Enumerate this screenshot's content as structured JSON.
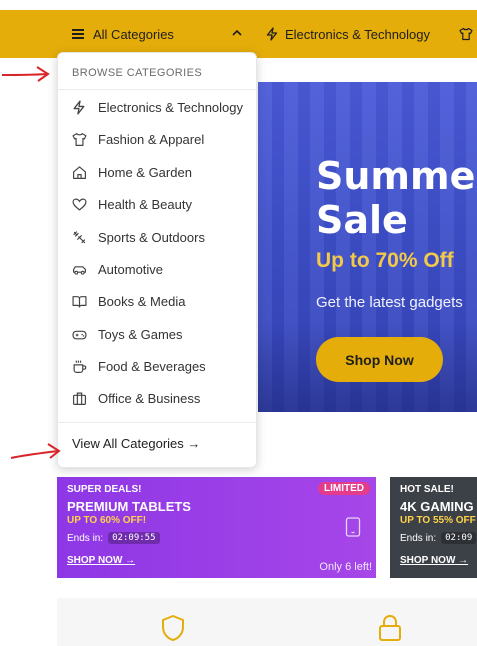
{
  "navbar": {
    "all_categories": "All Categories",
    "first_category": "Electronics & Technology",
    "bg_color": "#e5ad0a"
  },
  "hero": {
    "title_line1": "Summer",
    "title_line2": "Sale",
    "subtitle": "Up to 70% Off",
    "description": "Get the latest gadgets",
    "button": "Shop Now"
  },
  "dropdown": {
    "heading": "BROWSE CATEGORIES",
    "items": [
      {
        "label": "Electronics & Technology",
        "icon": "lightning-icon"
      },
      {
        "label": "Fashion & Apparel",
        "icon": "shirt-icon"
      },
      {
        "label": "Home & Garden",
        "icon": "home-icon"
      },
      {
        "label": "Health & Beauty",
        "icon": "heart-icon"
      },
      {
        "label": "Sports & Outdoors",
        "icon": "sports-icon"
      },
      {
        "label": "Automotive",
        "icon": "car-icon"
      },
      {
        "label": "Books & Media",
        "icon": "book-icon"
      },
      {
        "label": "Toys & Games",
        "icon": "gamepad-icon"
      },
      {
        "label": "Food & Beverages",
        "icon": "coffee-icon"
      },
      {
        "label": "Office & Business",
        "icon": "briefcase-icon"
      }
    ],
    "view_all": "View All Categories →"
  },
  "deals": [
    {
      "tag": "SUPER DEALS!",
      "title": "PREMIUM TABLETS",
      "discount": "UP TO 60% OFF!",
      "ends_label": "Ends in:",
      "timer": "02:09:55",
      "cta": "SHOP NOW →",
      "badge": "LIMITED",
      "stock": "Only 6 left!"
    },
    {
      "tag": "HOT SALE!",
      "title": "4K GAMING",
      "discount": "UP TO 55% OFF",
      "ends_label": "Ends in:",
      "timer": "02:09",
      "cta": "SHOP NOW →"
    }
  ],
  "colors": {
    "accent": "#e5ad0a",
    "hero_blue": "#3d4fc9",
    "deal_purple": "#9a3ee7",
    "deal_dark": "#3c4047"
  }
}
